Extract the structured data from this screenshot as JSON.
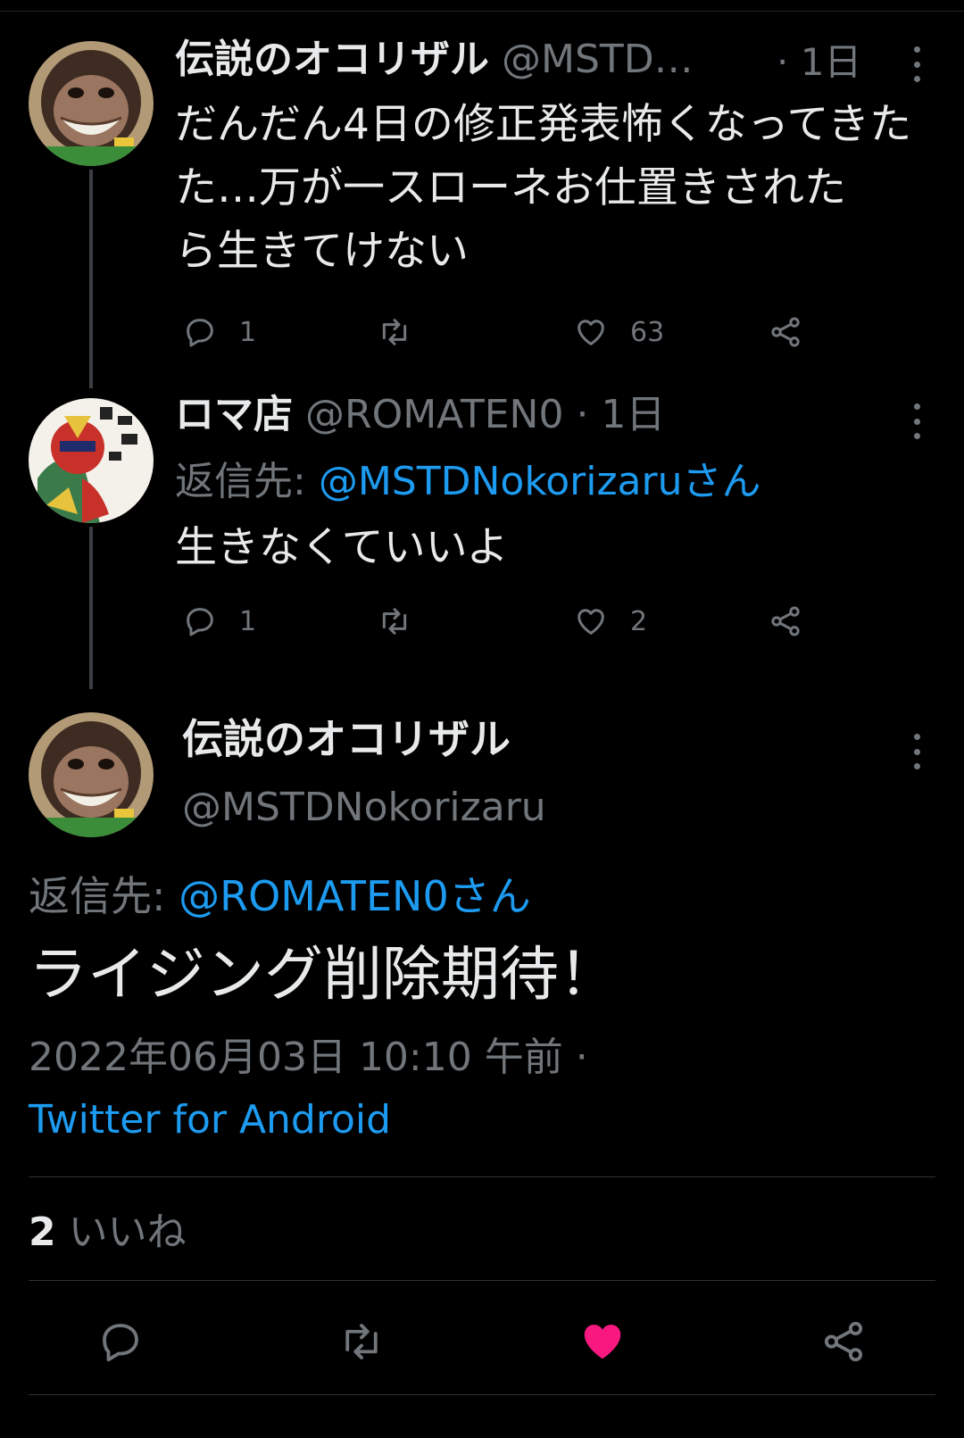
{
  "tweets": [
    {
      "name": "伝説のオコリザル",
      "handle": "@MSTD…",
      "time": "· 1日",
      "text": "だんだん4日の修正発表怖くなってきた…万が一スローネお仕置きされたら生きてけない",
      "lines": [
        "だんだん4日の修正発表怖くなってきた",
        "た…万が一スローネお仕置きされた",
        "ら生きてけない"
      ],
      "replies": "1",
      "retweets": "",
      "likes": "63"
    },
    {
      "name": "ロマ店",
      "handle": "@ROMATEN0",
      "time": "· 1日",
      "reply_prefix": "返信先:",
      "reply_to": "@MSTDNokorizaruさん",
      "text": "生きなくていいよ",
      "replies": "1",
      "retweets": "",
      "likes": "2"
    }
  ],
  "main": {
    "name": "伝説のオコリザル",
    "handle": "@MSTDNokorizaru",
    "reply_prefix": "返信先:",
    "reply_to": "@ROMATEN0さん",
    "text": "ライジング削除期待！",
    "timestamp": "2022年06月03日 10:10 午前 ·",
    "source": "Twitter for Android",
    "likes_count": "2",
    "likes_label": "いいね"
  },
  "icons": [
    "reply-icon",
    "retweet-icon",
    "like-icon",
    "share-icon",
    "more-icon"
  ],
  "colors": {
    "background": "#000000",
    "text": "#e7e9ea",
    "muted": "#71767b",
    "link": "#1d9bf0",
    "like_active": "#f91880"
  }
}
